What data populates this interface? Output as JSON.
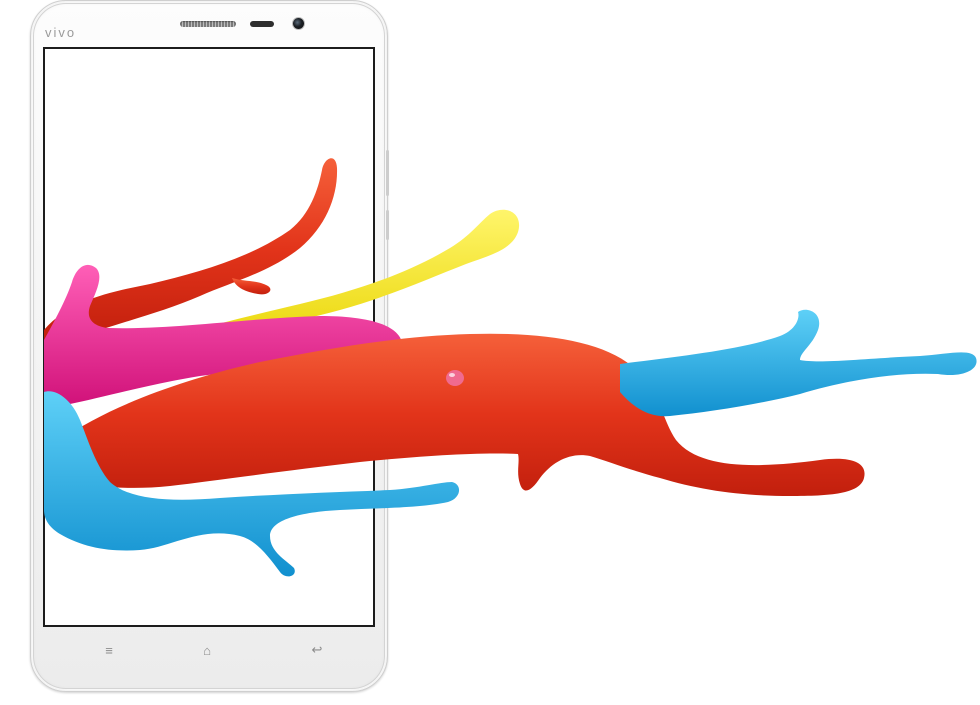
{
  "device": {
    "brand_logo": "vivo"
  },
  "navigation_keys": [
    {
      "name": "menu",
      "glyph": "≡"
    },
    {
      "name": "home",
      "glyph": "⌂"
    },
    {
      "name": "back",
      "glyph": "↩"
    }
  ],
  "colors": {
    "phone_body": "#f3f3f3",
    "screen_frame": "#1c1c1c",
    "paint_red": "#e43a1a",
    "paint_yellow": "#f5e81b",
    "paint_magenta": "#e8258f",
    "paint_blue": "#1ea9e3"
  }
}
